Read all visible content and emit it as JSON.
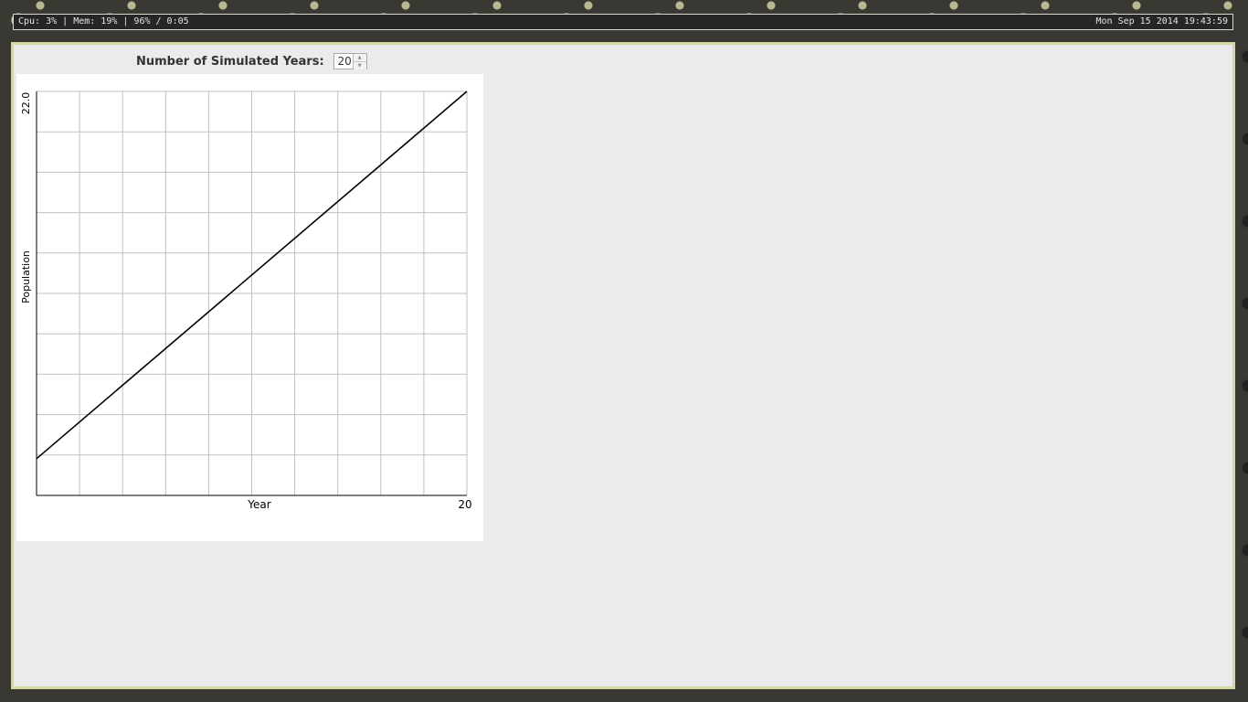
{
  "statusbar": {
    "left_text": "Cpu: 3% | Mem: 19% | 96% / 0:05",
    "right_text": "Mon Sep 15 2014 19:43:59"
  },
  "controls": {
    "years_label": "Number of Simulated Years:",
    "years_value": "20",
    "up_glyph": "▲",
    "down_glyph": "▼"
  },
  "chart_data": {
    "type": "line",
    "title": "",
    "xlabel": "Year",
    "ylabel": "Population",
    "x_tick_label": "20",
    "y_tick_label": "22.0",
    "xlim": [
      0,
      20
    ],
    "ylim": [
      0,
      22
    ],
    "grid": true,
    "series": [
      {
        "x": [
          0,
          20
        ],
        "values": [
          2,
          22
        ]
      }
    ],
    "line_color": "#000000",
    "grid_color": "#c0c0c0"
  }
}
